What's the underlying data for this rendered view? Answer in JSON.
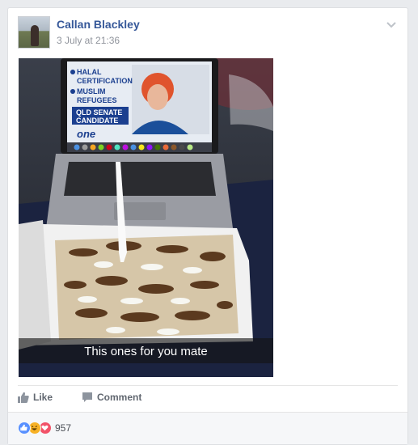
{
  "post": {
    "author": "Callan Blackley",
    "timestamp": "3 July at 21:36",
    "caption": "This ones for you mate",
    "screen_text": [
      "HALAL",
      "CERTIFICATION",
      "MUSLIM",
      "REFUGEES",
      "QLD SENATE",
      "CANDIDATE",
      "one"
    ]
  },
  "actions": {
    "like": "Like",
    "comment": "Comment"
  },
  "reactions": {
    "count": "957",
    "types": [
      "like-icon",
      "haha-icon",
      "love-icon"
    ]
  },
  "colors": {
    "link": "#365899",
    "muted": "#90949c",
    "like_blue": "#5890ff",
    "haha_yellow": "#f7b125",
    "love_red": "#f25268"
  }
}
